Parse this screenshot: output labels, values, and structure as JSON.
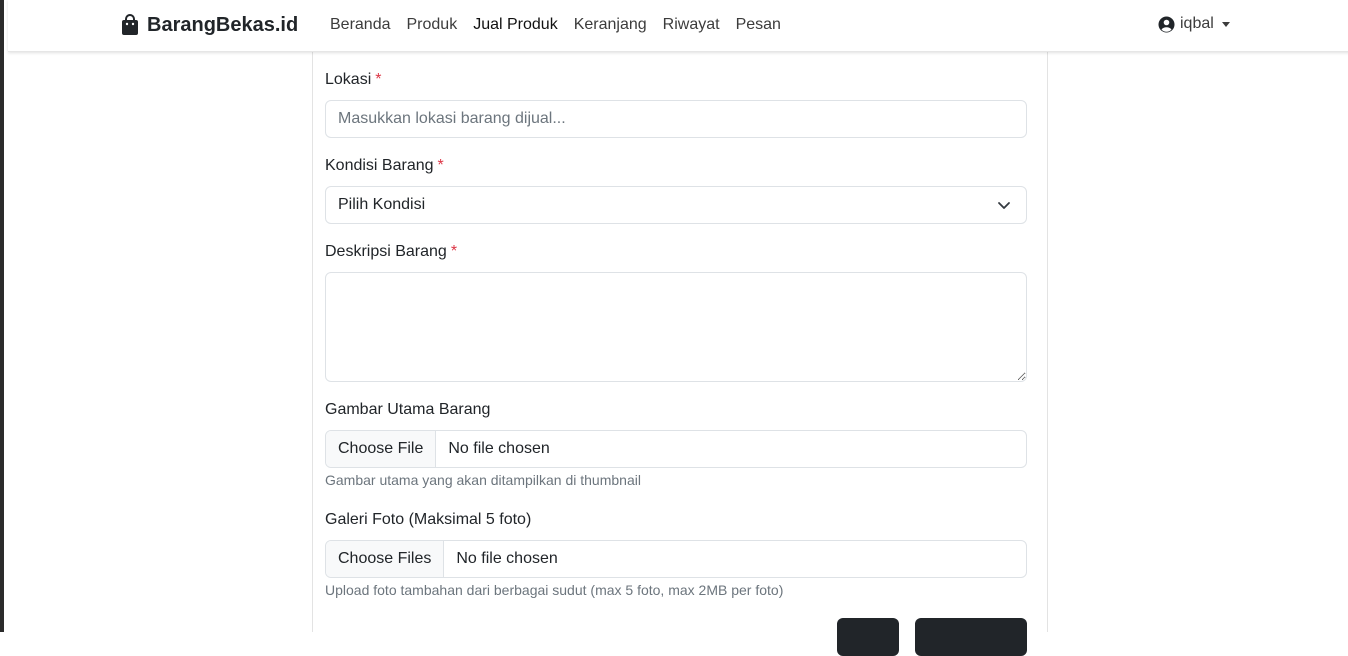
{
  "navbar": {
    "brand": "BarangBekas.id",
    "links": [
      {
        "label": "Beranda"
      },
      {
        "label": "Produk"
      },
      {
        "label": "Jual Produk"
      },
      {
        "label": "Keranjang"
      },
      {
        "label": "Riwayat"
      },
      {
        "label": "Pesan"
      }
    ],
    "user": "iqbal"
  },
  "form": {
    "lokasi": {
      "label": "Lokasi",
      "required_mark": "*",
      "placeholder": "Masukkan lokasi barang dijual..."
    },
    "kondisi": {
      "label": "Kondisi Barang",
      "required_mark": "*",
      "selected": "Pilih Kondisi"
    },
    "deskripsi": {
      "label": "Deskripsi Barang",
      "required_mark": "*"
    },
    "gambar_utama": {
      "label": "Gambar Utama Barang",
      "button": "Choose File",
      "status": "No file chosen",
      "help": "Gambar utama yang akan ditampilkan di thumbnail"
    },
    "galeri": {
      "label": "Galeri Foto (Maksimal 5 foto)",
      "button": "Choose Files",
      "status": "No file chosen",
      "help": "Upload foto tambahan dari berbagai sudut (max 5 foto, max 2MB per foto)"
    }
  },
  "colors": {
    "required": "#dc3545",
    "button_dark": "#212529",
    "help_text": "#6c757d"
  }
}
